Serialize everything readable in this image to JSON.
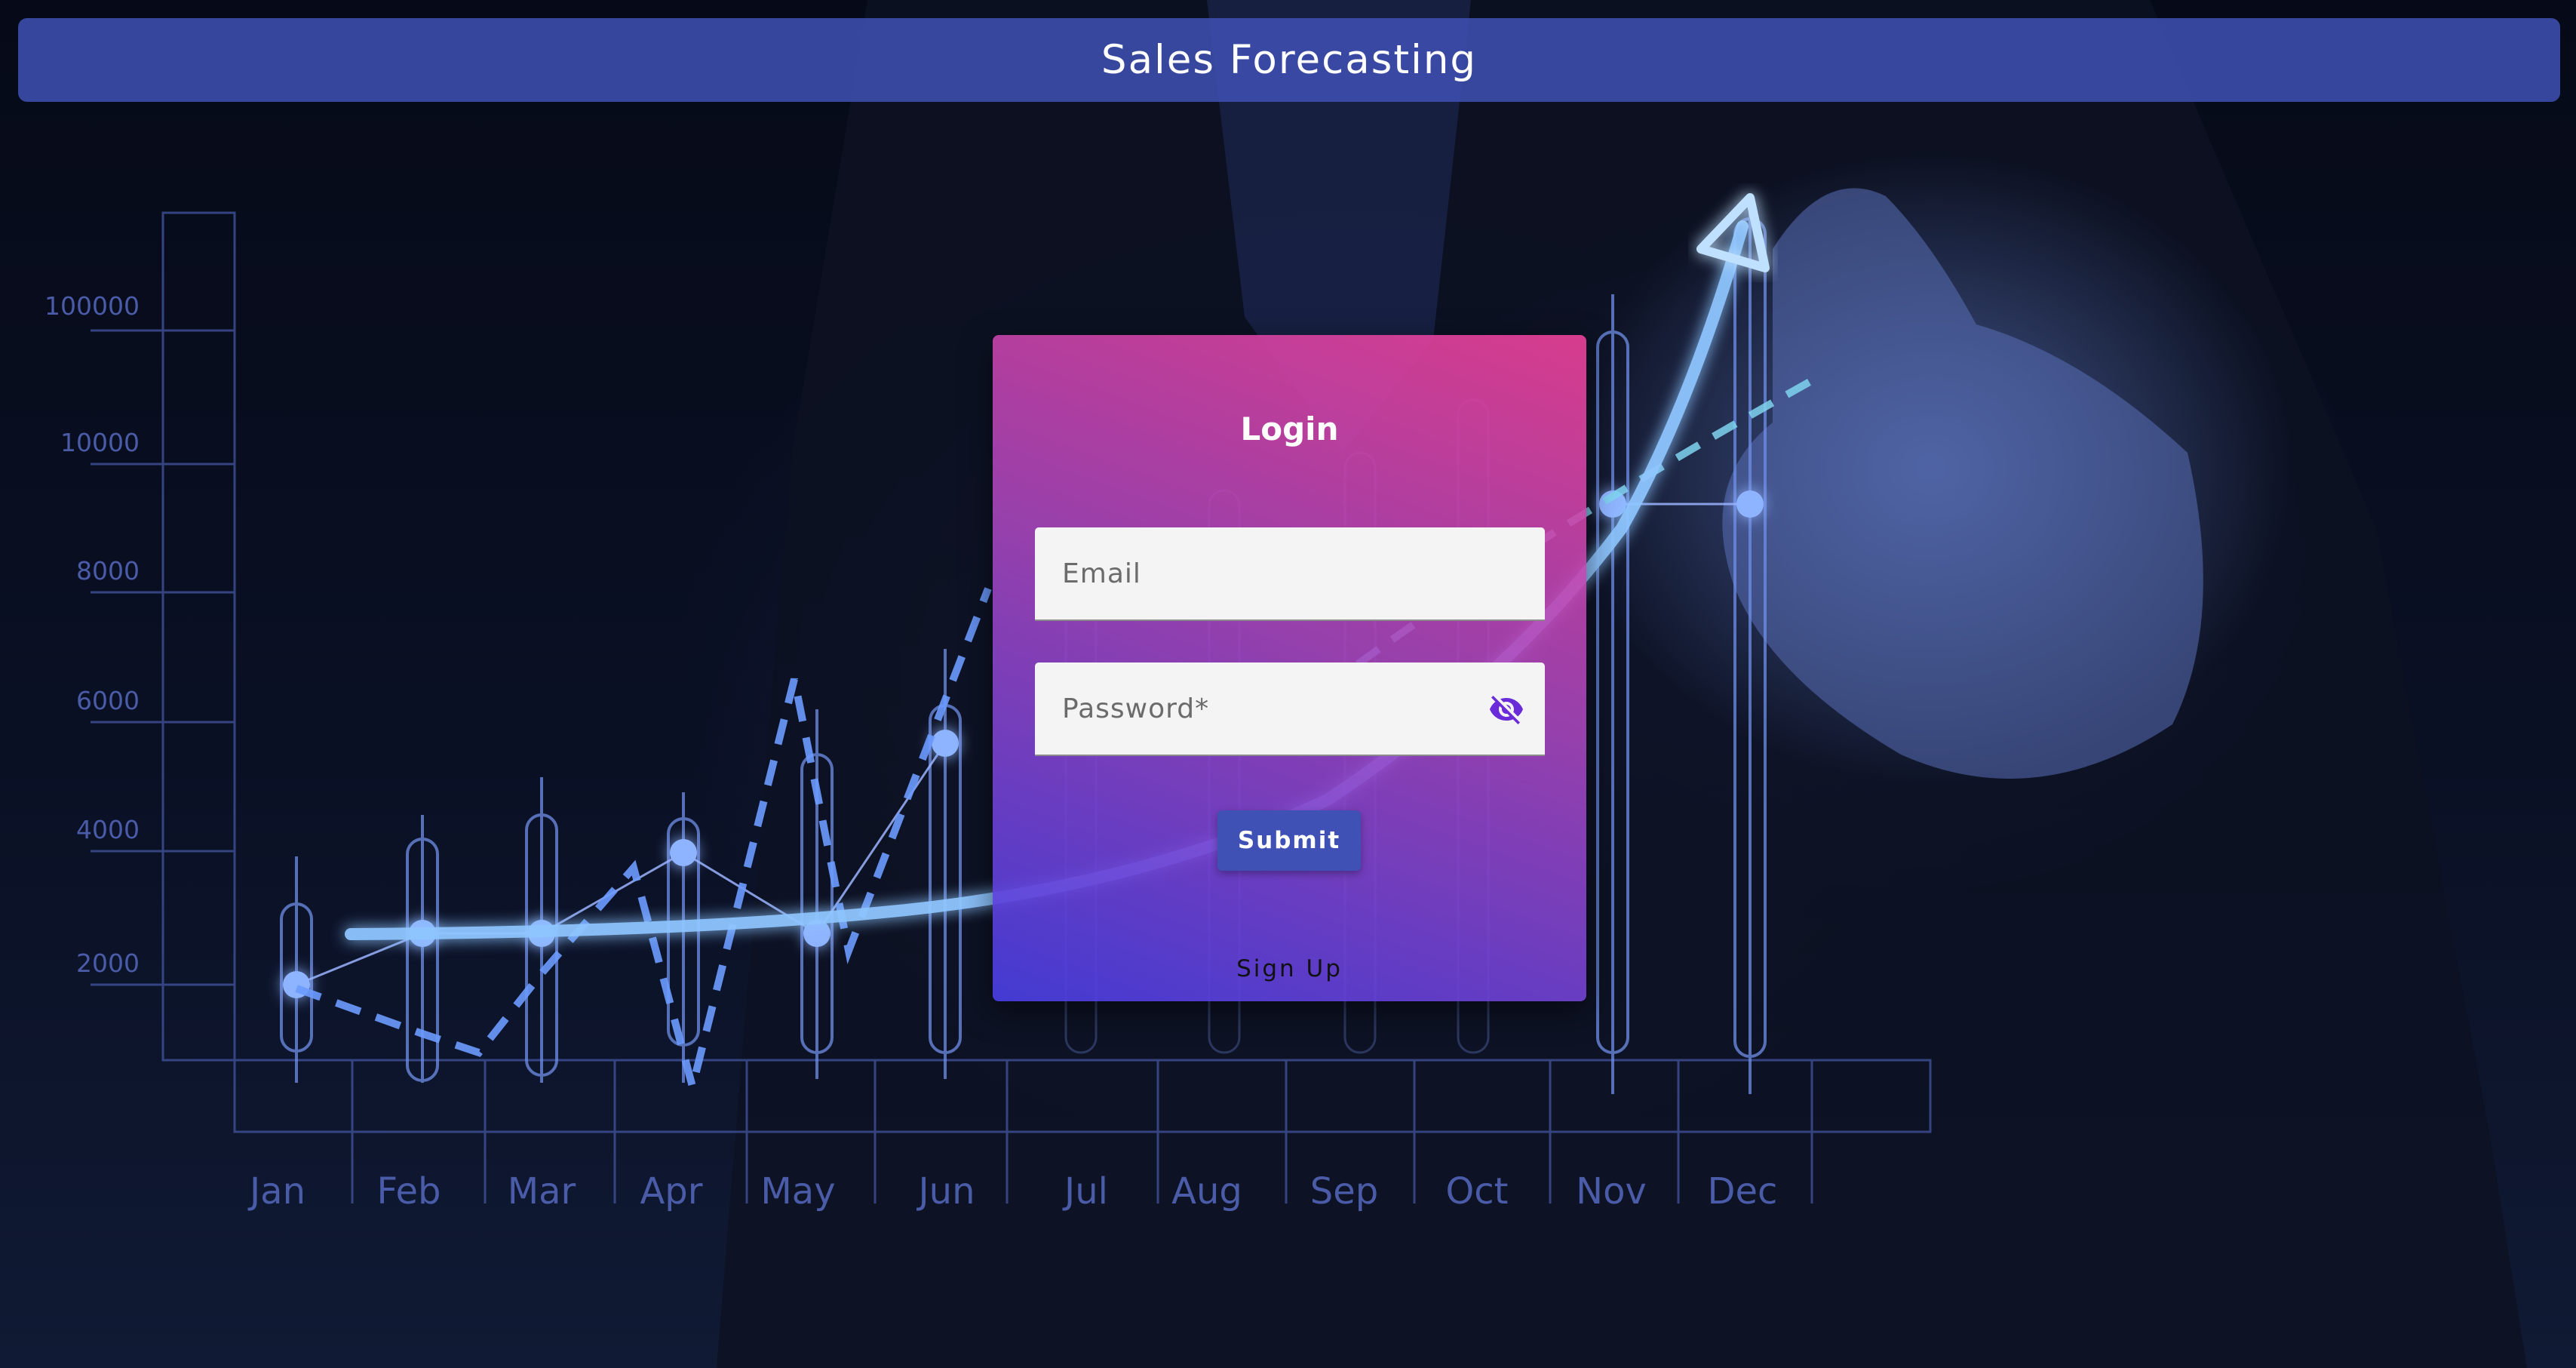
{
  "header": {
    "title": "Sales Forecasting"
  },
  "background_chart": {
    "y_ticks": [
      "100000",
      "10000",
      "8000",
      "6000",
      "4000",
      "2000"
    ],
    "months": [
      "Jan",
      "Feb",
      "Mar",
      "Apr",
      "May",
      "Jun",
      "Jul",
      "Aug",
      "Sep",
      "Oct",
      "Nov",
      "Dec"
    ]
  },
  "login": {
    "title": "Login",
    "email_placeholder": "Email",
    "password_placeholder": "Password*",
    "password_toggle_icon": "eye-off-icon",
    "submit_label": "Submit",
    "signup_label": "Sign Up"
  },
  "colors": {
    "header_bg": "#3f51b5",
    "card_gradient_top": "#e84096",
    "card_gradient_bottom": "#483ee1",
    "submit_bg": "#3f51b5",
    "icon_purple": "#6a2bd8"
  }
}
